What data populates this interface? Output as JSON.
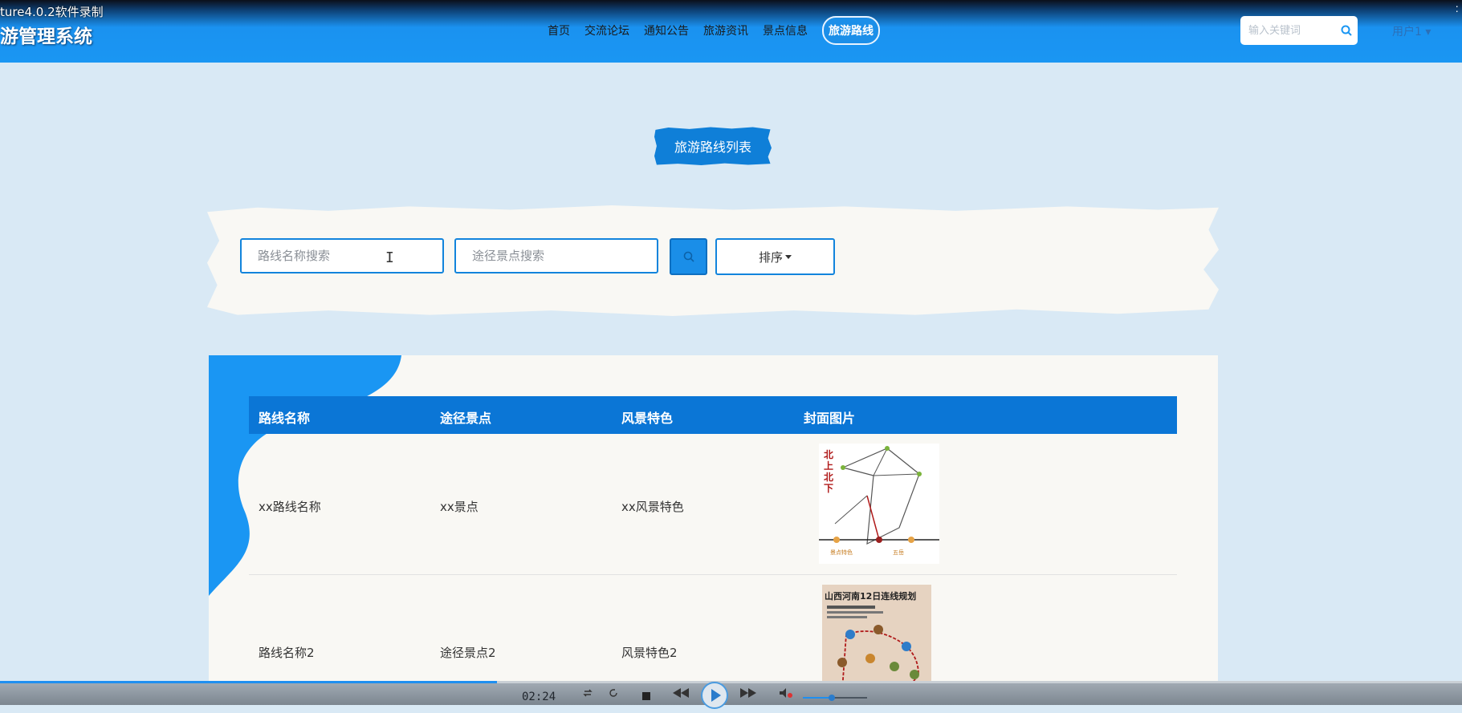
{
  "overlay": {
    "recorder_label": "ture4.0.2软件录制"
  },
  "header": {
    "site_title": "游管理系统",
    "nav": [
      {
        "label": "首页",
        "active": false
      },
      {
        "label": "交流论坛",
        "active": false
      },
      {
        "label": "通知公告",
        "active": false
      },
      {
        "label": "旅游资讯",
        "active": false
      },
      {
        "label": "景点信息",
        "active": false
      },
      {
        "label": "旅游路线",
        "active": true
      }
    ],
    "search_placeholder": "输入关键词",
    "user_label": "用户1"
  },
  "page": {
    "title": "旅游路线列表",
    "filters": {
      "route_name_placeholder": "路线名称搜索",
      "route_name_value": "",
      "spot_placeholder": "途径景点搜索",
      "spot_value": "",
      "sort_label": "排序"
    },
    "table": {
      "columns": [
        "路线名称",
        "途径景点",
        "风景特色",
        "封面图片"
      ],
      "rows": [
        {
          "name": "xx路线名称",
          "spots": "xx景点",
          "feature": "xx风景特色",
          "cover_icon": "route-map-image"
        },
        {
          "name": "路线名称2",
          "spots": "途径景点2",
          "feature": "风景特色2",
          "cover_icon": "route-poster-image",
          "cover_text": "山西河南12日连线规划"
        }
      ]
    }
  },
  "player": {
    "time": "02:24",
    "progress": 0.34
  },
  "colors": {
    "header": "#1a96f3",
    "accent": "#0b76d6",
    "background": "#d9e9f5",
    "card": "#f9f8f4"
  }
}
